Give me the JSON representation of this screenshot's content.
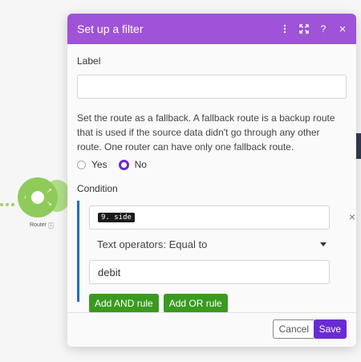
{
  "canvas": {
    "router_label": "Router",
    "router_badge": "1"
  },
  "dialog": {
    "title": "Set up a filter",
    "header_icons": [
      "more-vertical-icon",
      "expand-icon",
      "help-icon",
      "close-icon"
    ],
    "help_glyph": "?",
    "close_glyph": "×",
    "label_title": "Label",
    "label_value": "",
    "fallback_text": "Set the route as a fallback. A fallback route is a backup route that is used if the source data didn't go through any other route. One router can have only one fallback route.",
    "fallback_options": [
      {
        "label": "Yes",
        "selected": false
      },
      {
        "label": "No",
        "selected": true
      }
    ],
    "condition_title": "Condition",
    "condition": {
      "field_pill": "9. side",
      "operator": "Text operators: Equal to",
      "value": "debit",
      "remove_glyph": "×"
    },
    "add_and_label": "Add AND rule",
    "add_or_label": "Add OR rule",
    "cancel_label": "Cancel",
    "save_label": "Save"
  },
  "colors": {
    "header": "#9e53d9",
    "primary": "#6a2bd3",
    "green": "#3a9a1f",
    "condition_bar": "#1f6fc2",
    "router": "#8fcb5a"
  }
}
